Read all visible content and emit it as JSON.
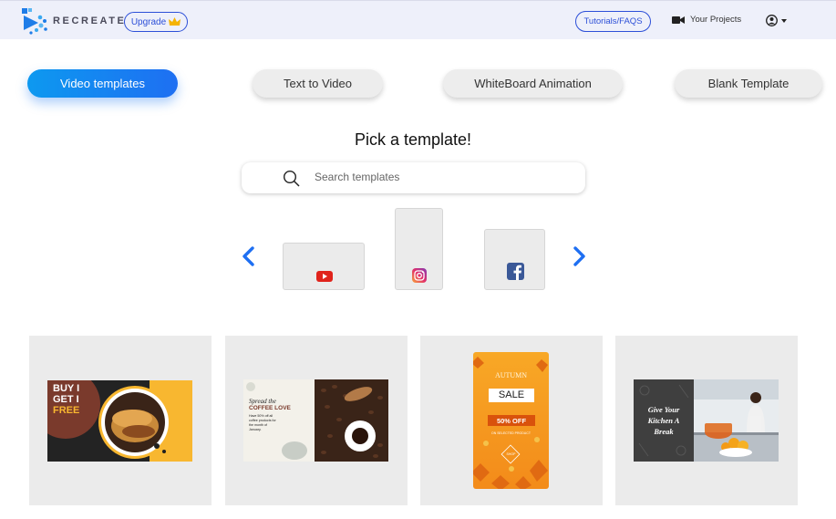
{
  "header": {
    "brand": "RECREATE",
    "upgrade_label": "Upgrade",
    "tutorials_label": "Tutorials/FAQS",
    "projects_label": "Your Projects"
  },
  "tabs": [
    {
      "label": "Video templates",
      "active": true
    },
    {
      "label": "Text to Video",
      "active": false
    },
    {
      "label": "WhiteBoard Animation",
      "active": false
    },
    {
      "label": "Blank Template",
      "active": false
    }
  ],
  "pick": {
    "title": "Pick a template!",
    "search_placeholder": "Search templates"
  },
  "platforms": [
    "youtube",
    "instagram",
    "facebook"
  ],
  "templates": [
    {
      "id": "burger",
      "lines": [
        "BUY I",
        "GET I",
        "FREE"
      ]
    },
    {
      "id": "coffee",
      "lines": [
        "Spread the",
        "COFFEE LOVE",
        "Have 50% off all",
        "coffee products for",
        "the month of",
        "January."
      ]
    },
    {
      "id": "autumn",
      "lines": [
        "AUTUMN",
        "SALE",
        "50% OFF",
        "ON SELECTED PRODUCT",
        "SHOP"
      ]
    },
    {
      "id": "kitchen",
      "lines": [
        "Give Your",
        "Kitchen A",
        "Break"
      ]
    }
  ],
  "colors": {
    "accent": "#1e7cf2",
    "outline": "#2c4fd8",
    "youtube": "#e0231b",
    "facebook": "#3b5998"
  }
}
